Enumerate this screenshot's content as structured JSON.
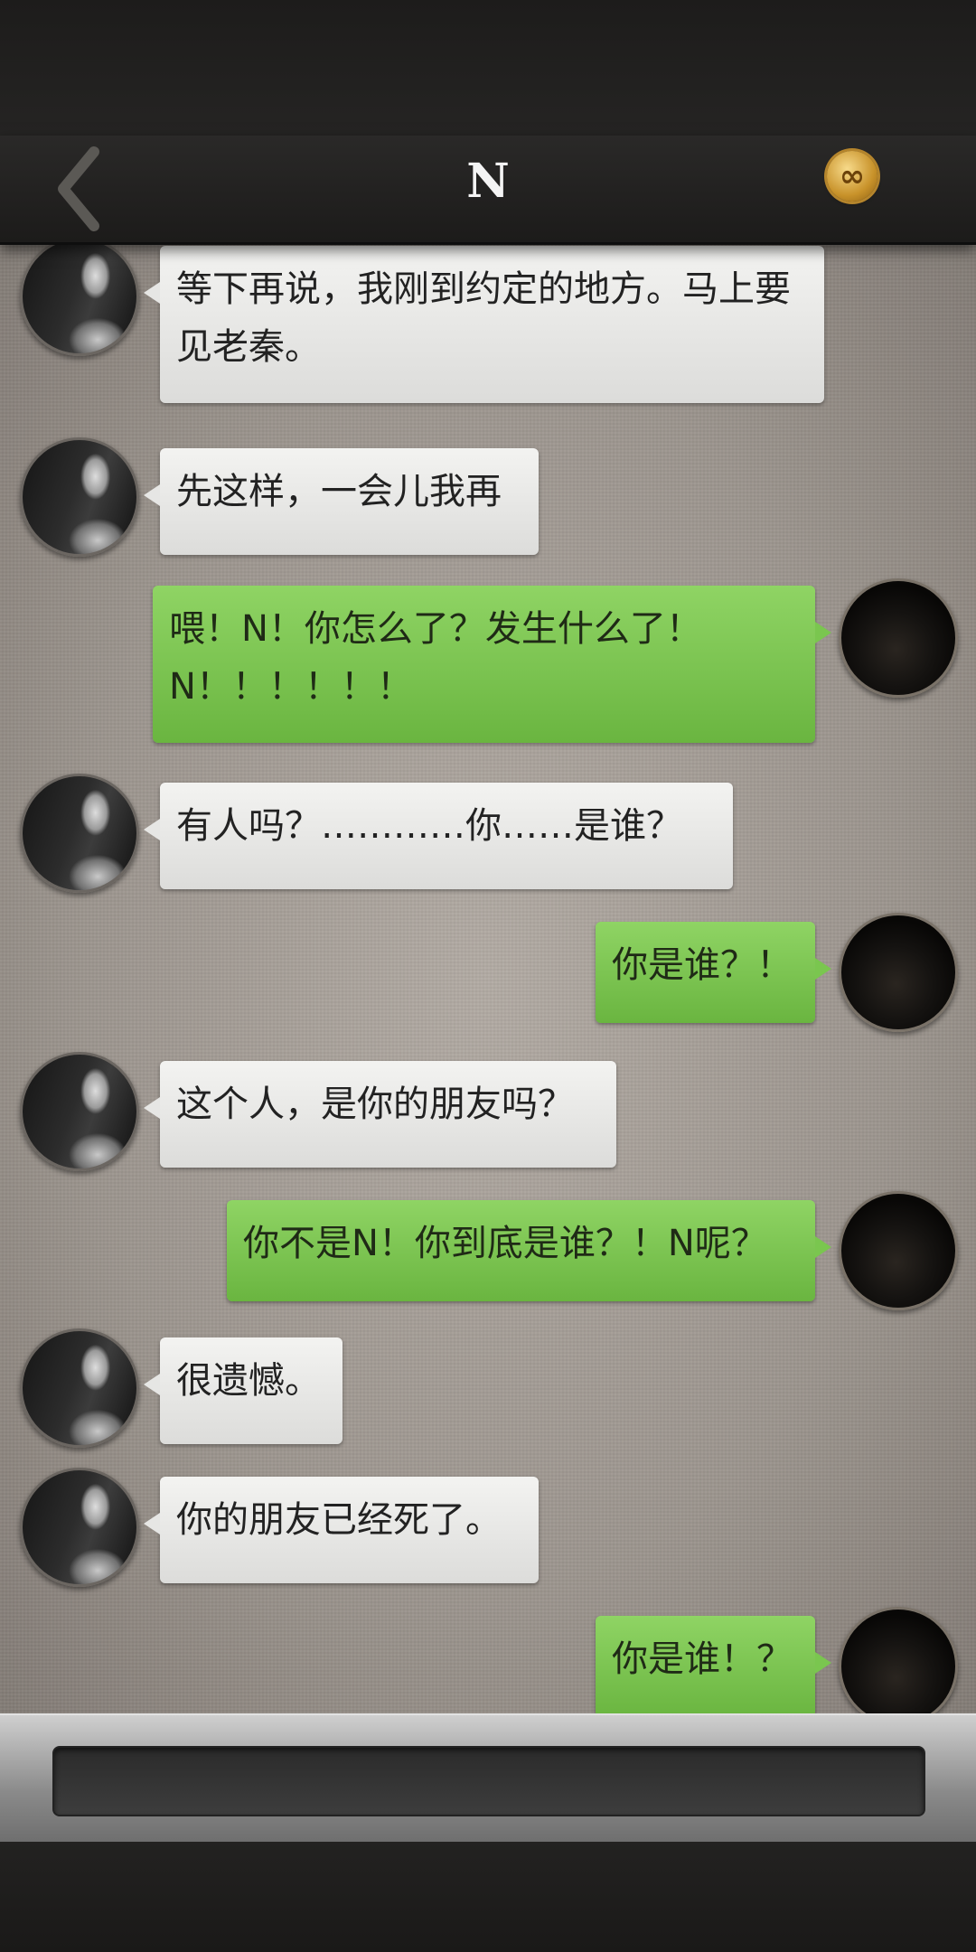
{
  "header": {
    "title": "N",
    "back_icon": "chevron-left-icon",
    "badge_icon": "infinity-coin-icon",
    "badge_symbol": "∞"
  },
  "messages": [
    {
      "from": "other",
      "text": "等下再说，我刚到约定的地方。马上要见老秦。"
    },
    {
      "from": "other",
      "text": "先这样，一会儿我再"
    },
    {
      "from": "self",
      "text": "喂！N！你怎么了？发生什么了！N！！！！！！"
    },
    {
      "from": "other",
      "text": "有人吗？…………你……是谁？"
    },
    {
      "from": "self",
      "text": "你是谁？！"
    },
    {
      "from": "other",
      "text": "这个人，是你的朋友吗？"
    },
    {
      "from": "self",
      "text": "你不是N！你到底是谁？！N呢？"
    },
    {
      "from": "other",
      "text": "很遗憾。"
    },
    {
      "from": "other",
      "text": "你的朋友已经死了。"
    },
    {
      "from": "self",
      "text": "你是谁！？"
    }
  ],
  "input": {
    "placeholder": ""
  },
  "colors": {
    "self_bubble": "#7ac64f",
    "other_bubble": "#e6e6e4",
    "nav_bg": "#232221"
  }
}
